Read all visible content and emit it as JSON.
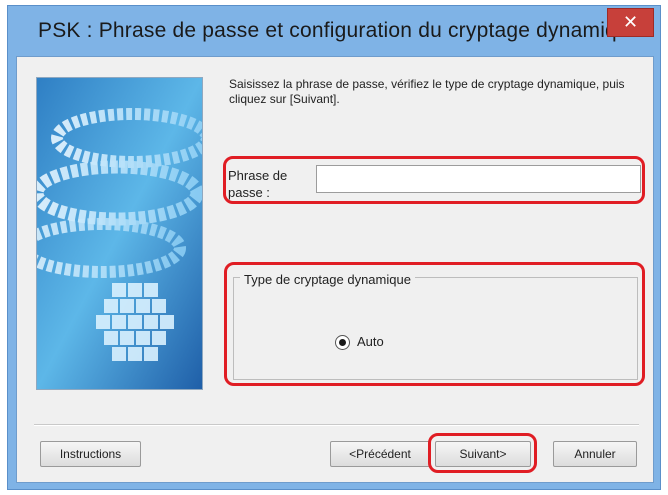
{
  "window": {
    "title": "PSK : Phrase de passe et configuration du cryptage dynamique",
    "close_glyph": "✕"
  },
  "instructions_text": "Saisissez la phrase de passe, vérifiez le type de cryptage dynamique, puis cliquez sur [Suivant].",
  "passphrase": {
    "label_line1": "Phrase de",
    "label_line2": "passe :",
    "value": ""
  },
  "encryption_group": {
    "title": "Type de cryptage dynamique",
    "option_label": "Auto",
    "selected": true
  },
  "buttons": {
    "instructions": "Instructions",
    "previous": "<Précédent",
    "next": "Suivant>",
    "cancel": "Annuler"
  },
  "colors": {
    "highlight": "#e01d24",
    "title_bar": "#7fb3e6",
    "close": "#c7403a"
  }
}
